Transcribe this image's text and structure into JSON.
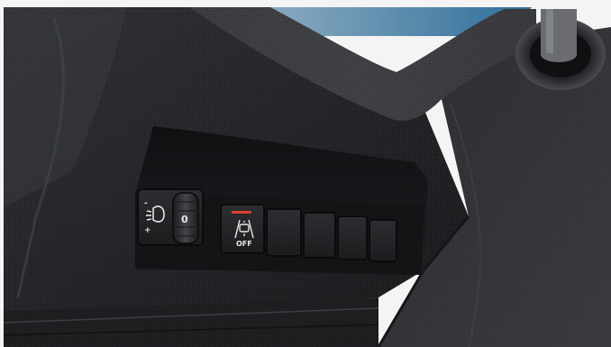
{
  "photo": {
    "subject": "car-dashboard-lower-left-switch-panel",
    "colors": {
      "plastic_dark": "#1b1c1e",
      "plastic_mid": "#2a2b2e",
      "plastic_light": "#3b3d41",
      "carbon_trim": "#2f3033",
      "bezel": "#141517",
      "windshield": "#4e87a8",
      "warning_red": "#d9412b",
      "symbol_white": "#e8e8e8"
    }
  },
  "controls": {
    "headlight_leveller": {
      "icon": "headlamp-level-icon",
      "minus_mark": "-",
      "plus_mark": "+",
      "dial_value": "0"
    },
    "lane_assist_button": {
      "icon": "lane-departure-icon",
      "label": "OFF",
      "indicator_led": "off"
    },
    "blank_switches": {
      "count": 4
    }
  }
}
